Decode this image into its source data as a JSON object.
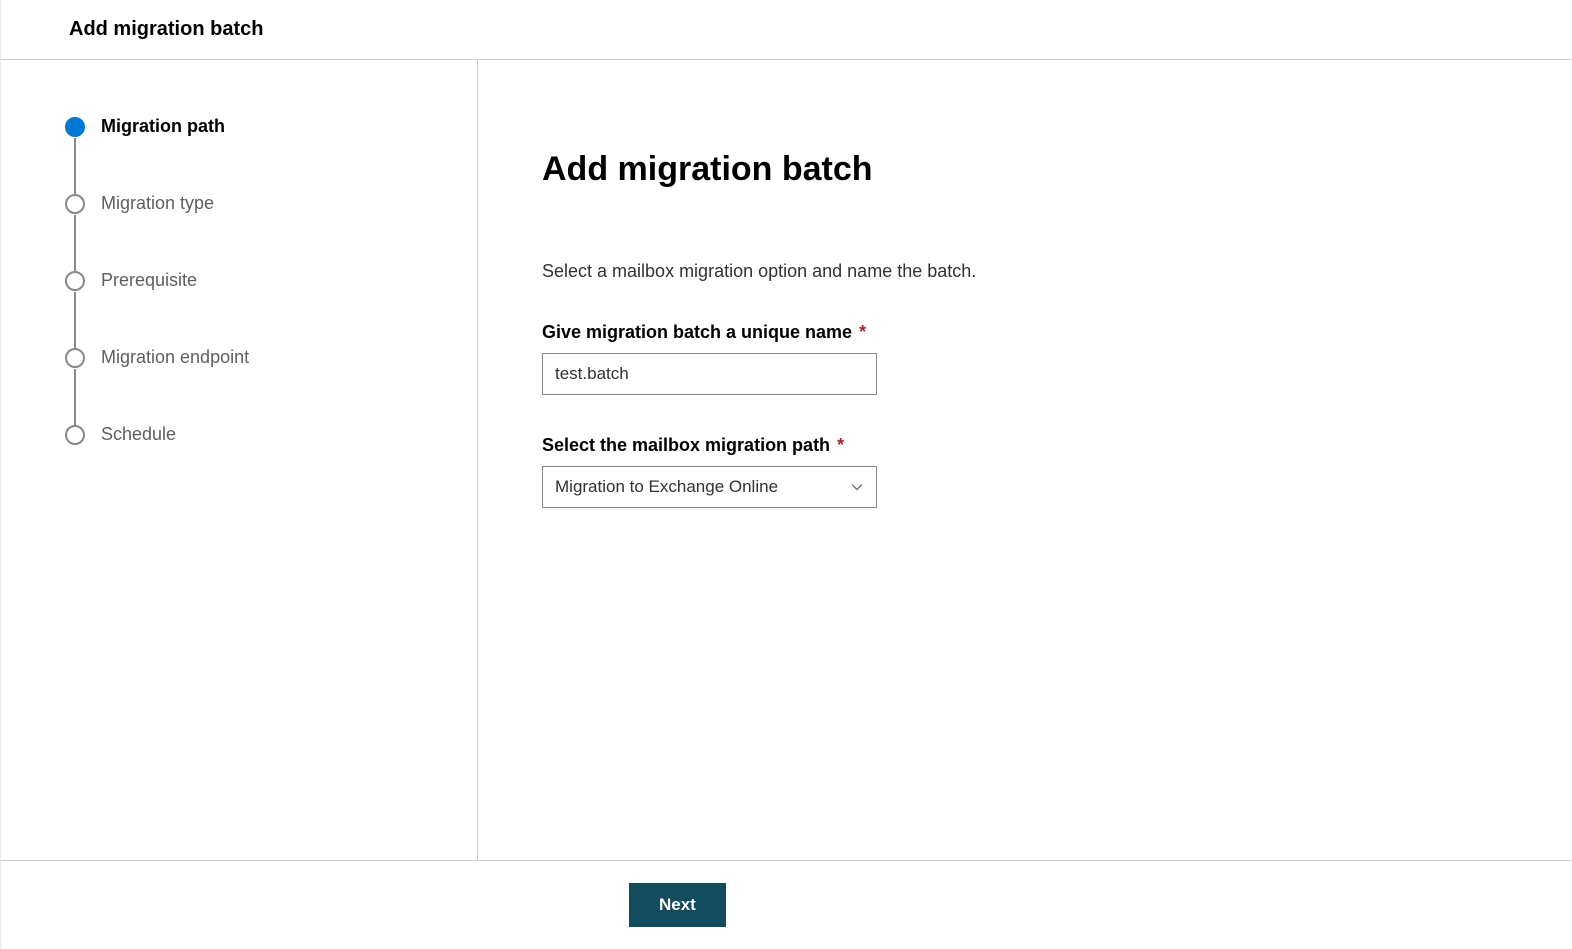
{
  "header": {
    "title": "Add migration batch"
  },
  "sidebar": {
    "steps": [
      {
        "label": "Migration path",
        "active": true
      },
      {
        "label": "Migration type",
        "active": false
      },
      {
        "label": "Prerequisite",
        "active": false
      },
      {
        "label": "Migration endpoint",
        "active": false
      },
      {
        "label": "Schedule",
        "active": false
      }
    ]
  },
  "main": {
    "title": "Add migration batch",
    "description": "Select a mailbox migration option and name the batch.",
    "name_field": {
      "label": "Give migration batch a unique name",
      "value": "test.batch"
    },
    "path_field": {
      "label": "Select the mailbox migration path",
      "selected": "Migration to Exchange Online"
    }
  },
  "footer": {
    "next_label": "Next"
  },
  "colors": {
    "accent": "#0078d4",
    "button_bg": "#134b5f",
    "required": "#a4262c"
  }
}
